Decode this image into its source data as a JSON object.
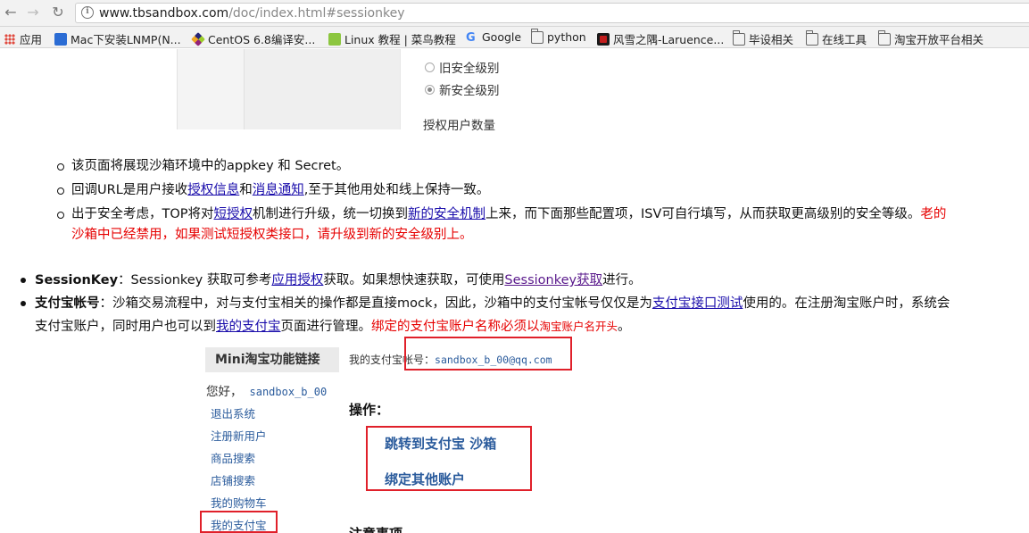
{
  "browser": {
    "url_host": "www.tbsandbox.com",
    "url_path": "/doc/index.html#sessionkey",
    "bookmarks": [
      {
        "label": "应用",
        "icon": "apps-icon"
      },
      {
        "label": "Mac下安装LNMP(N...",
        "icon": "site-icon"
      },
      {
        "label": "CentOS 6.8编译安...",
        "icon": "centos-icon"
      },
      {
        "label": "Linux 教程 | 菜鸟教程",
        "icon": "runoob-icon"
      },
      {
        "label": "Google",
        "icon": "google-icon"
      },
      {
        "label": "python",
        "icon": "folder-icon"
      },
      {
        "label": "风雪之隅-Laruence...",
        "icon": "laruence-icon"
      },
      {
        "label": "毕设相关",
        "icon": "folder-icon"
      },
      {
        "label": "在线工具",
        "icon": "folder-icon"
      },
      {
        "label": "淘宝开放平台相关",
        "icon": "folder-icon"
      }
    ]
  },
  "security_panel": {
    "option_old": "旧安全级别",
    "option_new": "新安全级别",
    "auth_users": "授权用户数量"
  },
  "notes": {
    "n1": "该页面将展现沙箱环境中的appkey 和 Secret。",
    "n2_pre": "回调URL是用户接收",
    "n2_link1": "授权信息",
    "n2_mid": "和",
    "n2_link2": "消息通知",
    "n2_post": ",至于其他用处和线上保持一致。",
    "n3_pre": "出于安全考虑，TOP将对",
    "n3_link1": "短授权",
    "n3_mid": "机制进行升级，统一切换到",
    "n3_link2": "新的安全机制",
    "n3_post": "上来，而下面那些配置项，ISV可自行填写，从而获取更高级别的安全等级。",
    "n3_red_cut": "老的",
    "n3_red_line2": "沙箱中已经禁用，如果测试短授权类接口，请升级到新的安全级别上。"
  },
  "main": {
    "sk_label": "SessionKey",
    "sk_pre": "：Sessionkey 获取可参考",
    "sk_link1": "应用授权",
    "sk_mid": "获取。如果想快速获取，可使用",
    "sk_link2": "Sessionkey获取",
    "sk_post": "进行。",
    "alipay_label": "支付宝帐号",
    "alipay_pre": "：沙箱交易流程中，对与支付宝相关的操作都是直接mock，因此，沙箱中的支付宝帐号仅仅是为",
    "alipay_link1": "支付宝接口测试",
    "alipay_post": "使用的。在注册淘宝账户时，系统会",
    "alipay_line2_pre": "支付宝账户，同时用户也可以到",
    "alipay_link2": "我的支付宝",
    "alipay_line2_mid": "页面进行管理。",
    "alipay_red": "绑定的支付宝账户名称必须以",
    "alipay_red_small": "淘宝账户名开头",
    "alipay_end": "。"
  },
  "mini": {
    "title": "Mini淘宝功能链接",
    "greet": "您好，",
    "username": "sandbox_b_00",
    "links": [
      "退出系统",
      "注册新用户",
      "商品搜索",
      "店铺搜索",
      "我的购物车",
      "我的支付宝"
    ],
    "acct_label": "我的支付宝帐号：",
    "acct_email": "sandbox_b_00@qq.com",
    "ops_label": "操作：",
    "op1": "跳转到支付宝 沙箱",
    "op2": "绑定其他账户",
    "cut_heading": "注意事项"
  },
  "colors": {
    "link": "#1a0dab",
    "visited": "#5a1a8c",
    "warning_red": "#e60000",
    "highlight_box": "#e0202a",
    "mini_link": "#2a5b9c"
  }
}
